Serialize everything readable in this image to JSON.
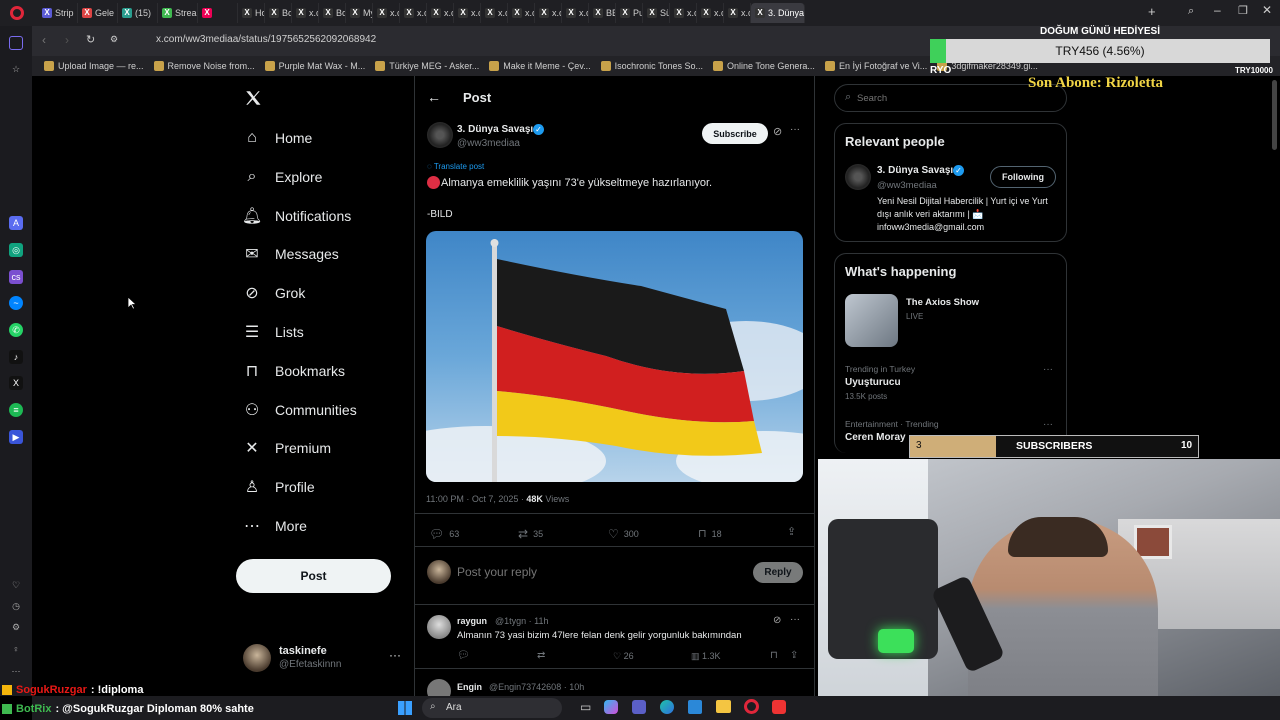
{
  "browser": {
    "tabs": [
      {
        "label": "Strip",
        "color": "#5b5bd6"
      },
      {
        "label": "Gele",
        "color": "#d44"
      },
      {
        "label": "(15)",
        "color": "#2a9d8f"
      },
      {
        "label": "Strea",
        "color": "#3fb950"
      },
      {
        "label": "",
        "color": "#e05"
      },
      {
        "label": "Hom",
        "color": "#333"
      },
      {
        "label": "Boşu",
        "color": "#333"
      },
      {
        "label": "x.co",
        "color": "#333"
      },
      {
        "label": "Boşu",
        "color": "#333"
      },
      {
        "label": "Myn",
        "color": "#333"
      },
      {
        "label": "x.co",
        "color": "#333"
      },
      {
        "label": "x.co",
        "color": "#333"
      },
      {
        "label": "x.co",
        "color": "#333"
      },
      {
        "label": "x.co",
        "color": "#333"
      },
      {
        "label": "x.co",
        "color": "#333"
      },
      {
        "label": "x.co",
        "color": "#333"
      },
      {
        "label": "x.co",
        "color": "#333"
      },
      {
        "label": "x.co",
        "color": "#333"
      },
      {
        "label": "BELL",
        "color": "#333"
      },
      {
        "label": "Push",
        "color": "#333"
      },
      {
        "label": "Süre",
        "color": "#333"
      },
      {
        "label": "x.co",
        "color": "#333"
      },
      {
        "label": "x.co",
        "color": "#333"
      },
      {
        "label": "x.co",
        "color": "#333"
      },
      {
        "label": "3. Dünya",
        "color": "#333",
        "active": true
      }
    ],
    "url": "x.com/ww3mediaa/status/1975652562092068942",
    "bookmarks": [
      "Upload Image — re...",
      "Remove Noise from...",
      "Purple Mat Wax - M...",
      "Türkiye MEG - Asker...",
      "Make it Meme - Çev...",
      "Isochronic Tones So...",
      "Online Tone Genera...",
      "En İyi Fotoğraf ve Vi...",
      "3dgifmaker28349.gi..."
    ]
  },
  "x_nav": {
    "items": [
      {
        "label": "Home",
        "icon": "home-icon"
      },
      {
        "label": "Explore",
        "icon": "search-icon"
      },
      {
        "label": "Notifications",
        "icon": "bell-icon"
      },
      {
        "label": "Messages",
        "icon": "envelope-icon"
      },
      {
        "label": "Grok",
        "icon": "grok-icon"
      },
      {
        "label": "Lists",
        "icon": "list-icon"
      },
      {
        "label": "Bookmarks",
        "icon": "bookmark-icon"
      },
      {
        "label": "Communities",
        "icon": "people-icon"
      },
      {
        "label": "Premium",
        "icon": "x-logo-icon"
      },
      {
        "label": "Profile",
        "icon": "person-icon"
      },
      {
        "label": "More",
        "icon": "more-circle-icon"
      }
    ],
    "post_label": "Post",
    "account": {
      "name": "taskinefe",
      "handle": "@Efetaskinnn"
    }
  },
  "post": {
    "header": "Post",
    "author_name": "3. Dünya Savaşı",
    "author_handle": "@ww3mediaa",
    "subscribe_label": "Subscribe",
    "translate_label": "Translate post",
    "text": "Almanya emeklilik yaşını 73'e yükseltmeye hazırlanıyor.",
    "source": "-BILD",
    "time": "11:00 PM · Oct 7, 2025 · ",
    "views_count": "48K",
    "views_label": " Views",
    "replies": "63",
    "reposts": "35",
    "likes": "300",
    "bookmarks": "18",
    "reply_placeholder": "Post your reply",
    "reply_button": "Reply"
  },
  "replies": [
    {
      "name": "raygun",
      "handle": "@1tygn · 11h",
      "text": "Almanın 73 yasi bizim 47lere felan denk gelir yorgunluk bakımından",
      "replies": "",
      "reposts": "",
      "likes": "26",
      "views": "1.3K"
    },
    {
      "name": "Engin",
      "handle": "@Engin73742608 · 10h"
    }
  ],
  "right": {
    "search_placeholder": "Search",
    "relevant_title": "Relevant people",
    "person": {
      "name": "3. Dünya Savaşı",
      "handle": "@ww3mediaa",
      "follow_label": "Following",
      "bio": "Yeni Nesil Dijital Habercilik | Yurt içi ve Yurt dışı anlık veri aktarımı | 📩 infoww3media@gmail.com"
    },
    "happening_title": "What's happening",
    "live": {
      "title": "The Axios Show",
      "status": "LIVE"
    },
    "trends": [
      {
        "meta": "Trending in Turkey",
        "name": "Uyuşturucu",
        "posts": "13.5K posts"
      },
      {
        "meta": "Entertainment · Trending",
        "name": "Ceren Moray",
        "posts": ""
      }
    ]
  },
  "overlay": {
    "birthday": "DOĞUM GÜNÜ HEDİYESİ",
    "goal": "TRY456 (4.56%)",
    "goal_left": "RYO",
    "goal_right": "TRY10000",
    "last_sub": "Son Abone: Rizoletta",
    "sub_current": "3",
    "sub_label": "SUBSCRIBERS",
    "sub_goal": "10",
    "sub_progress": 0.3
  },
  "chat": [
    {
      "user": "SogukRuzgar",
      "msg": ": !diploma",
      "color": "#e91916"
    },
    {
      "user": "BotRix",
      "msg": ": @SogukRuzgar Diploman 80% sahte",
      "color": "#3fb950"
    }
  ],
  "taskbar": {
    "search": "Ara"
  }
}
